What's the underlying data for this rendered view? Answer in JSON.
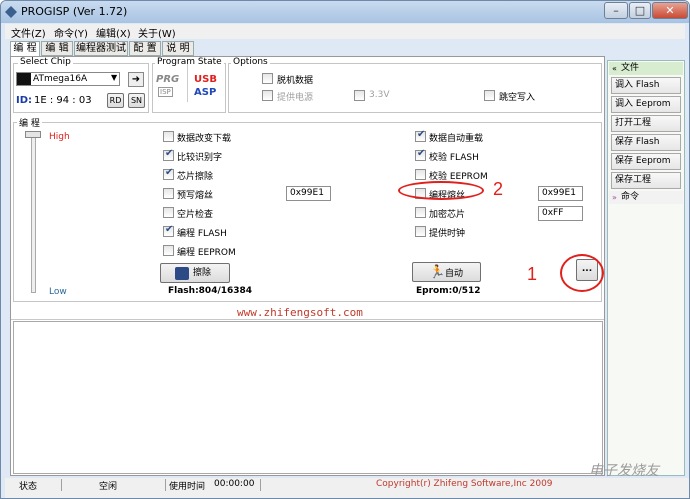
{
  "window": {
    "title": "PROGISP (Ver 1.72)"
  },
  "menu": [
    "文件(Z)",
    "命令(Y)",
    "编辑(X)",
    "关于(W)"
  ],
  "tabs": [
    "编 程",
    "编 辑",
    "编程器测试",
    "配 置",
    "说 明"
  ],
  "select_chip": {
    "label": "Select Chip",
    "value": "ATmega16A",
    "id_label": "ID:",
    "id_value": "1E : 94 : 03",
    "rd": "RD",
    "sn": "SN"
  },
  "program_state": {
    "label": "Program State",
    "prg": "PRG",
    "isp": "ISP",
    "usb": "USB",
    "asp": "ASP"
  },
  "options": {
    "label": "Options",
    "offline": "脱机数据",
    "power": "提供电源",
    "v33": "3.3V",
    "jump": "跳空写入"
  },
  "program": {
    "label": "编 程",
    "high": "High",
    "low": "Low",
    "left_checks": [
      {
        "label": "数据改变下载",
        "checked": false
      },
      {
        "label": "比较识别字",
        "checked": true
      },
      {
        "label": "芯片擦除",
        "checked": true
      },
      {
        "label": "预写熔丝",
        "checked": false
      },
      {
        "label": "空片检查",
        "checked": false
      },
      {
        "label": "编程 FLASH",
        "checked": true
      },
      {
        "label": "编程 EEPROM",
        "checked": false
      }
    ],
    "right_checks": [
      {
        "label": "数据自动重载",
        "checked": true
      },
      {
        "label": "校验 FLASH",
        "checked": true
      },
      {
        "label": "校验 EEPROM",
        "checked": false
      },
      {
        "label": "编程熔丝",
        "checked": false
      },
      {
        "label": "加密芯片",
        "checked": false
      },
      {
        "label": "提供时钟",
        "checked": false
      }
    ],
    "fuse_pre": "0x99E1",
    "fuse_prog": "0x99E1",
    "lock": "0xFF",
    "erase_btn": "擦除",
    "auto_btn": "自动",
    "more_btn": "...",
    "flash_info": "Flash:804/16384",
    "eprom_info": "Eprom:0/512",
    "website": "www.zhifengsoft.com"
  },
  "annotations": {
    "n1": "1",
    "n2": "2"
  },
  "sidebar": {
    "file_header": "文件",
    "items": [
      "调入 Flash",
      "调入 Eeprom",
      "打开工程",
      "保存 Flash",
      "保存 Eeprom",
      "保存工程"
    ],
    "cmd_header": "命令"
  },
  "status": {
    "state_label": "状态",
    "state_value": "空闲",
    "time_label": "使用时间",
    "time_value": "00:00:00",
    "copyright": "Copyright(r) Zhifeng Software,Inc 2009",
    "watermark": "电子发烧友"
  },
  "colors": {
    "accent_red": "#e0201c",
    "website": "#c0392b"
  }
}
